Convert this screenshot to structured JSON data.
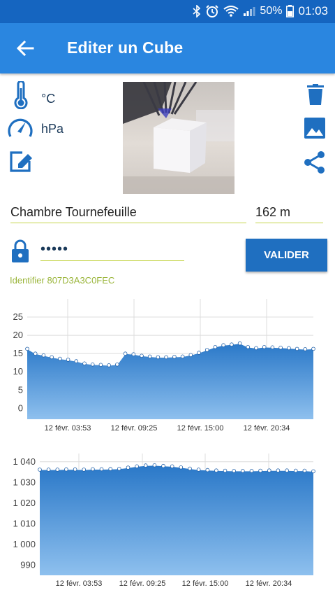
{
  "status_bar": {
    "battery": "50%",
    "time": "01:03"
  },
  "app_bar": {
    "title": "Editer un Cube",
    "back_icon": "arrow-left-icon"
  },
  "units": {
    "temperature": "°C",
    "pressure": "hPa"
  },
  "form": {
    "name_value": "Chambre Tournefeuille",
    "altitude_value": "162 m",
    "password_value": "•••••",
    "validate_label": "VALIDER",
    "identifier": "Identifier 807D3A3C0FEC"
  },
  "colors": {
    "primary": "#2a86e0",
    "status_bar": "#1565c0",
    "button": "#1f6fc0",
    "accent_green": "#9ab53a",
    "icon_blue": "#1f6fc0"
  },
  "chart_data": [
    {
      "type": "area",
      "x_tick_labels": [
        "12 févr. 03:53",
        "12 févr. 09:25",
        "12 févr. 15:00",
        "12 févr. 20:34"
      ],
      "y_tick_labels": [
        "0",
        "5",
        "10",
        "15",
        "20",
        "25"
      ],
      "ylim": [
        -3,
        30
      ],
      "grid": true,
      "series": [
        {
          "values": [
            16.3,
            15.0,
            14.5,
            14.0,
            13.6,
            13.3,
            12.9,
            12.3,
            12.0,
            11.9,
            11.8,
            12.0,
            15.0,
            14.8,
            14.4,
            14.2,
            14.0,
            14.0,
            14.1,
            14.2,
            14.6,
            15.2,
            16.0,
            16.8,
            17.3,
            17.5,
            17.8,
            16.8,
            16.5,
            16.8,
            16.7,
            16.6,
            16.5,
            16.3,
            16.2,
            16.3
          ]
        }
      ]
    },
    {
      "type": "area",
      "x_tick_labels": [
        "12 févr. 03:53",
        "12 févr. 09:25",
        "12 févr. 15:00",
        "12 févr. 20:34"
      ],
      "y_tick_labels": [
        "990",
        "1 000",
        "1 010",
        "1 020",
        "1 030",
        "1 040"
      ],
      "ylim": [
        985,
        1044
      ],
      "grid": true,
      "series": [
        {
          "values": [
            1036.2,
            1036.2,
            1036.2,
            1036.3,
            1036.3,
            1036.2,
            1036.4,
            1036.4,
            1036.5,
            1036.6,
            1037.2,
            1037.8,
            1038.2,
            1038.3,
            1038.0,
            1037.8,
            1037.3,
            1036.7,
            1036.2,
            1036.0,
            1035.8,
            1035.7,
            1035.6,
            1035.6,
            1035.6,
            1035.7,
            1035.8,
            1035.8,
            1035.8,
            1035.7,
            1035.7,
            1035.4
          ]
        }
      ]
    }
  ]
}
